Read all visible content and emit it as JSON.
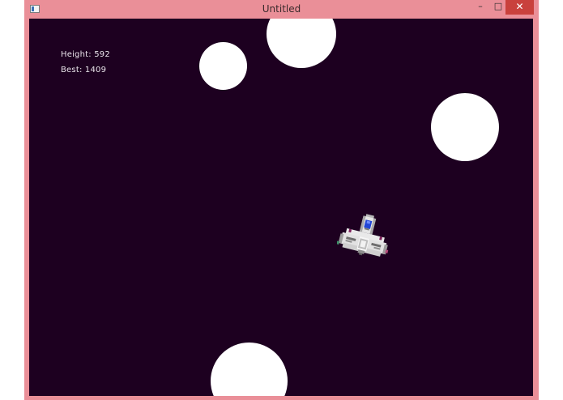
{
  "window": {
    "title": "Untitled",
    "minimize_glyph": "–",
    "maximize_glyph": "□",
    "close_glyph": "✕"
  },
  "hud": {
    "height": "Height: 592",
    "best": "Best: 1409"
  },
  "game": {
    "background_color": "#1d0020",
    "asteroid_color": "#ffffff"
  },
  "icons": [
    "app-icon",
    "minimize-icon",
    "maximize-icon",
    "close-icon",
    "spaceship-icon"
  ]
}
